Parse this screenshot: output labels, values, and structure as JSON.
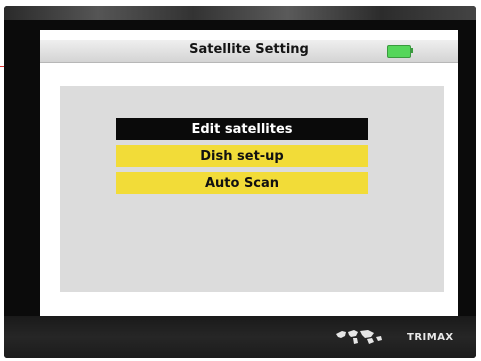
{
  "screen": {
    "title": "Satellite Setting",
    "battery_icon": "battery-icon"
  },
  "menu": {
    "items": [
      {
        "label": "Edit satellites",
        "selected": true
      },
      {
        "label": "Dish set-up",
        "selected": false
      },
      {
        "label": "Auto Scan",
        "selected": false
      }
    ]
  },
  "footer": {
    "brand": "TRIMAX",
    "logo_icon": "world-map-icon"
  },
  "colors": {
    "highlight": "#0a0a0a",
    "item_background": "#f2dc38",
    "content_background": "#dcdcdc",
    "battery": "#55d65a"
  }
}
